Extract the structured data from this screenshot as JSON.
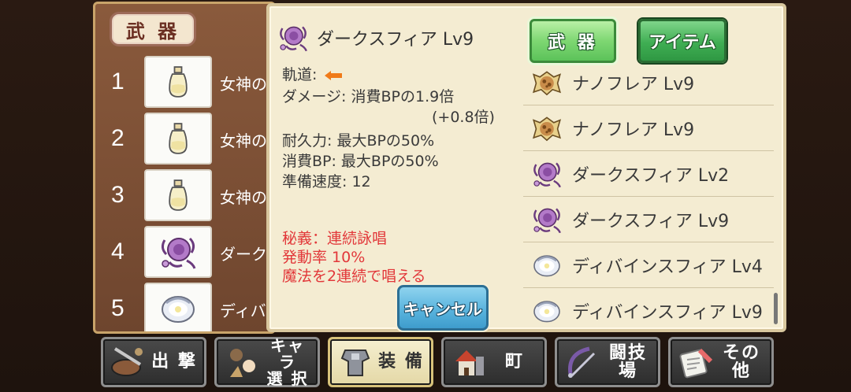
{
  "left_panel": {
    "title": "武 器",
    "weapons": [
      {
        "num": "1",
        "name": "女神の",
        "icon": "bottle-icon"
      },
      {
        "num": "2",
        "name": "女神の",
        "icon": "bottle-icon"
      },
      {
        "num": "3",
        "name": "女神の",
        "icon": "bottle-icon"
      },
      {
        "num": "4",
        "name": "ダーク",
        "icon": "dark-sphere-icon"
      },
      {
        "num": "5",
        "name": "ディバ",
        "icon": "divine-sphere-icon"
      }
    ]
  },
  "detail": {
    "name": "ダークスフィア Lv9",
    "icon": "dark-sphere-icon",
    "trajectory_label": "軌道:",
    "trajectory_icon": "left-arrow-icon",
    "damage": "ダメージ: 消費BPの1.9倍",
    "damage_bonus": "(+0.8倍)",
    "durability": "耐久力: 最大BPの50%",
    "bp_cost": "消費BP: 最大BPの50%",
    "prep_speed": "準備速度: 12",
    "secret_title": "秘義：連続詠唱",
    "secret_rate": "発動率 10%",
    "secret_desc": "魔法を2連続で唱える",
    "cancel_label": "キャンセル"
  },
  "tabs": {
    "weapon": "武 器",
    "item": "アイテム"
  },
  "inventory": [
    {
      "name": "ナノフレア Lv9",
      "icon": "nano-flare-icon"
    },
    {
      "name": "ナノフレア Lv9",
      "icon": "nano-flare-icon"
    },
    {
      "name": "ダークスフィア Lv2",
      "icon": "dark-sphere-icon"
    },
    {
      "name": "ダークスフィア Lv9",
      "icon": "dark-sphere-icon"
    },
    {
      "name": "ディバインスフィア Lv4",
      "icon": "divine-sphere-icon"
    },
    {
      "name": "ディバインスフィア Lv9",
      "icon": "divine-sphere-icon"
    }
  ],
  "nav": [
    {
      "label": "出 撃",
      "icon": "sortie-icon"
    },
    {
      "label": "キャラ\n選 択",
      "icon": "character-select-icon"
    },
    {
      "label": "装 備",
      "icon": "armor-icon",
      "active": true
    },
    {
      "label": "町",
      "icon": "town-icon"
    },
    {
      "label": "闘技場",
      "icon": "arena-icon"
    },
    {
      "label": "その他",
      "icon": "other-icon"
    }
  ],
  "colors": {
    "accent_red": "#e2383a",
    "panel_bg": "#f4ecd2",
    "green_tab": "#5cc25a",
    "blue_button": "#5ab4de"
  }
}
